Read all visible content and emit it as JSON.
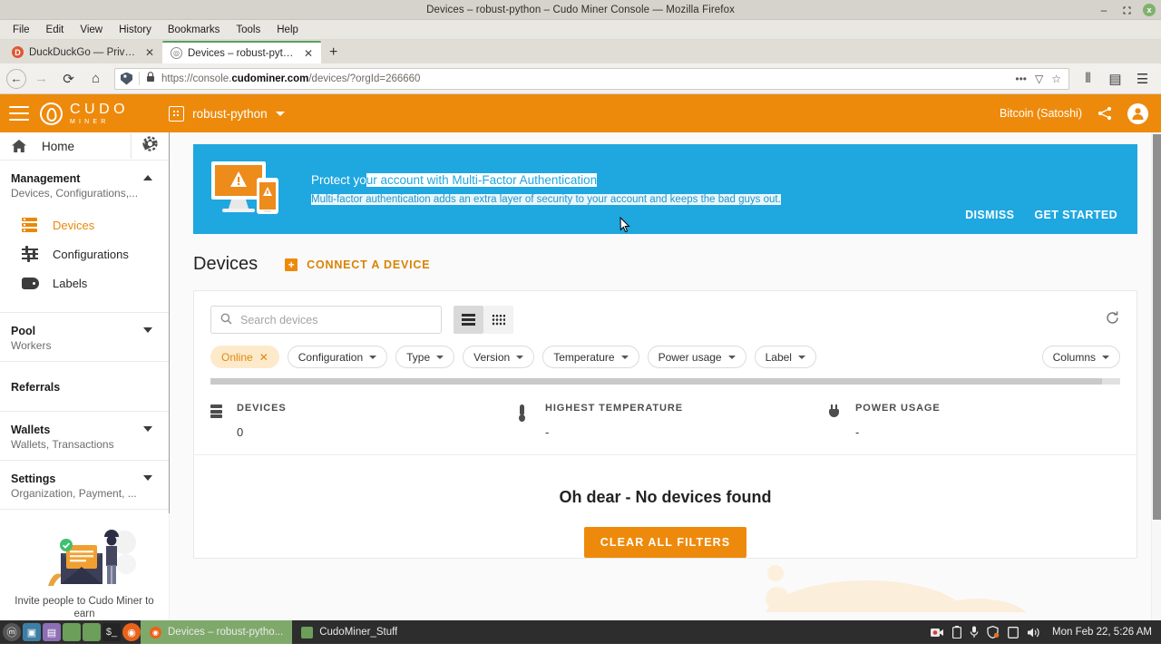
{
  "window": {
    "title": "Devices – robust-python – Cudo Miner Console — Mozilla Firefox",
    "minimize": "–",
    "maximize": "⛶",
    "close": "x"
  },
  "menubar": [
    "File",
    "Edit",
    "View",
    "History",
    "Bookmarks",
    "Tools",
    "Help"
  ],
  "tabs": [
    {
      "title": "DuckDuckGo — Privacy, si",
      "title_dim": "mp",
      "favicon": "duckduckgo-icon",
      "close": "✕",
      "active": false
    },
    {
      "title": "Devices – robust-python – C",
      "title_dim": "",
      "favicon": "cudo-icon",
      "close": "✕",
      "active": true
    }
  ],
  "newtab_label": "+",
  "navbar": {
    "back": "←",
    "forward": "→",
    "reload": "⟳",
    "home": "⌂",
    "url_prefix": "https://console.",
    "url_bold": "cudominer.com",
    "url_suffix": "/devices/?orgId=266660",
    "lock": "🔒",
    "page_actions": "•••",
    "pocket": "▽",
    "bookmark": "☆",
    "library": "⫴",
    "sidebar": "▤",
    "appmenu": "☰"
  },
  "app_header": {
    "brand_top": "CUDO",
    "brand_bottom": "MINER",
    "org_name": "robust-python",
    "currency": "Bitcoin (Satoshi)",
    "share_icon": "share-icon",
    "avatar_icon": "account-icon"
  },
  "sidebar": {
    "home_label": "Home",
    "settings_icon": "gear-icon",
    "groups": [
      {
        "title": "Management",
        "subtitle": "Devices, Configurations,...",
        "arrow": "up",
        "links": [
          {
            "label": "Devices",
            "icon": "devices-icon",
            "active": true
          },
          {
            "label": "Configurations",
            "icon": "configurations-icon",
            "active": false
          },
          {
            "label": "Labels",
            "icon": "labels-icon",
            "active": false
          }
        ]
      },
      {
        "title": "Pool",
        "subtitle": "Workers",
        "arrow": "down",
        "links": []
      },
      {
        "title": "Referrals",
        "subtitle": "",
        "arrow": "",
        "links": []
      },
      {
        "title": "Wallets",
        "subtitle": "Wallets, Transactions",
        "arrow": "down",
        "links": []
      },
      {
        "title": "Settings",
        "subtitle": "Organization, Payment, ...",
        "arrow": "down",
        "links": []
      }
    ],
    "promo_text": "Invite people to Cudo Miner to earn"
  },
  "banner": {
    "title_plain": "Protect yo",
    "title_selected": "ur account with Multi-Factor Authentication",
    "subtitle_selected": "Multi-factor authentication adds an extra layer of security to your account and keeps the bad guys out.",
    "dismiss_label": "DISMISS",
    "get_started_label": "GET STARTED"
  },
  "page": {
    "title": "Devices",
    "connect_label": "CONNECT A DEVICE",
    "connect_plus": "+"
  },
  "toolbar": {
    "search_placeholder": "Search devices",
    "search_value": "",
    "search_icon": "search-icon",
    "view_list": "list-view-icon",
    "view_grid": "grid-view-icon",
    "refresh_icon": "refresh-icon"
  },
  "filters": [
    {
      "label": "Online",
      "type": "active",
      "remove": "✕"
    },
    {
      "label": "Configuration",
      "type": "dropdown"
    },
    {
      "label": "Type",
      "type": "dropdown"
    },
    {
      "label": "Version",
      "type": "dropdown"
    },
    {
      "label": "Temperature",
      "type": "dropdown"
    },
    {
      "label": "Power usage",
      "type": "dropdown"
    },
    {
      "label": "Label",
      "type": "dropdown"
    }
  ],
  "columns_filter": {
    "label": "Columns"
  },
  "stats": [
    {
      "label": "DEVICES",
      "value": "0",
      "icon": "server-icon"
    },
    {
      "label": "HIGHEST TEMPERATURE",
      "value": "-",
      "icon": "thermometer-icon"
    },
    {
      "label": "POWER USAGE",
      "value": "-",
      "icon": "plug-icon"
    }
  ],
  "empty_state": {
    "title": "Oh dear - No devices found",
    "button_label": "CLEAR ALL FILTERS"
  },
  "taskbar": {
    "launchers": [
      "ubuntu-icon",
      "camera-icon",
      "text-editor-icon",
      "app-green-icon",
      "files-icon",
      "terminal-icon",
      "firefox-icon"
    ],
    "windows": [
      {
        "title": "Devices – robust-pytho...",
        "icon": "firefox-icon",
        "active": true
      },
      {
        "title": "CudoMiner_Stuff",
        "icon": "folder-icon",
        "active": false
      }
    ],
    "tray": [
      "record-icon",
      "battery-icon",
      "microphone-icon",
      "shield-icon",
      "display-icon",
      "volume-icon"
    ],
    "clock": "Mon Feb 22, 5:26 AM"
  },
  "colors": {
    "brand_orange": "#ee8a0b",
    "banner_blue": "#1fa7e0",
    "taskbar_active": "#7fa96b"
  }
}
